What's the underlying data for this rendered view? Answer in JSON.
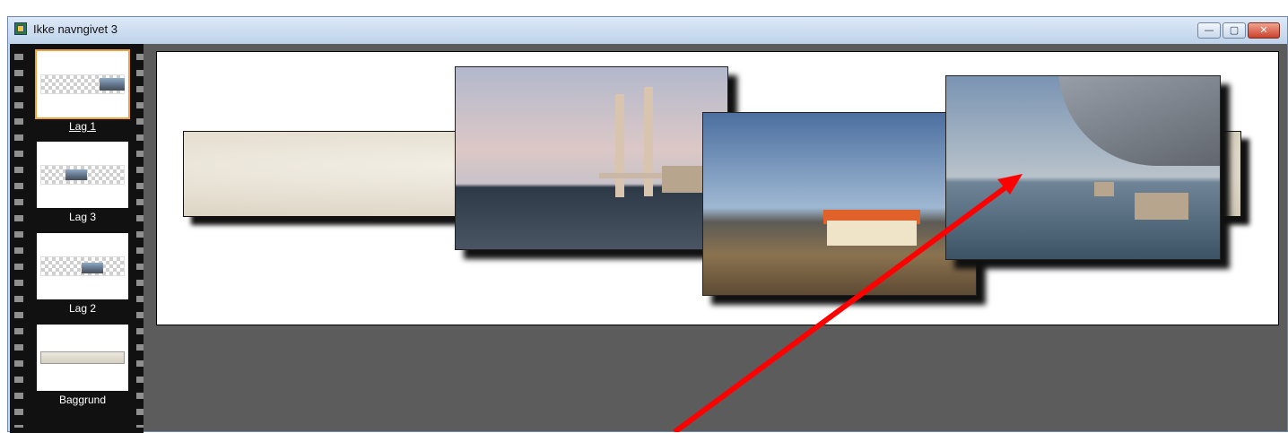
{
  "window": {
    "title": "Ikke navngivet 3",
    "controls": {
      "minimize": "—",
      "maximize": "▢",
      "close": "✕"
    }
  },
  "layers": [
    {
      "label": "Lag 1",
      "selected": true,
      "thumb": "photo-right"
    },
    {
      "label": "Lag 3",
      "selected": false,
      "thumb": "photo-center"
    },
    {
      "label": "Lag 2",
      "selected": false,
      "thumb": "photo-center-right"
    },
    {
      "label": "Baggrund",
      "selected": false,
      "thumb": "paper"
    }
  ],
  "canvas": {
    "background_color": "#ffffff",
    "workspace_color": "#5c5c5c",
    "items": [
      "crumpled-paper-strip",
      "bridge-photo",
      "coast-house-photo",
      "under-bridge-photo"
    ]
  },
  "annotation": {
    "color": "#ff0000",
    "type": "arrow"
  },
  "colors": {
    "selection": "#f2a13a",
    "titlebar": "#c7daef",
    "filmstrip": "#111111"
  }
}
